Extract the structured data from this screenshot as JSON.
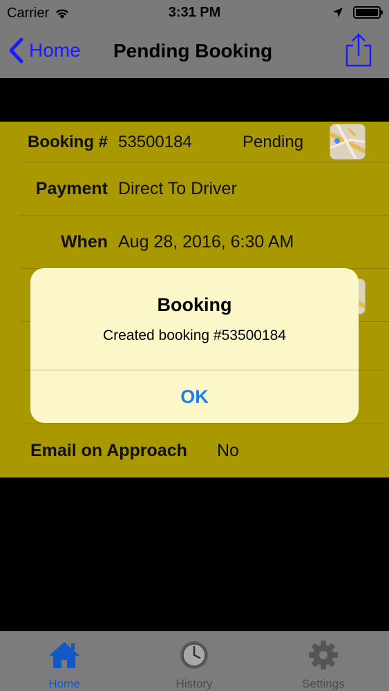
{
  "status_bar": {
    "carrier": "Carrier",
    "time": "3:31 PM"
  },
  "nav": {
    "back_label": "Home",
    "title": "Pending Booking"
  },
  "booking": {
    "label": "Booking #",
    "number": "53500184",
    "status": "Pending"
  },
  "payment": {
    "label": "Payment",
    "value": "Direct To Driver"
  },
  "when": {
    "label": "When",
    "value": "Aug 28, 2016, 6:30 AM"
  },
  "email_on_approach": {
    "label": "Email on Approach",
    "value": "No"
  },
  "alert": {
    "title": "Booking",
    "message": "Created booking #53500184",
    "ok_label": "OK"
  },
  "tabs": [
    {
      "label": "Home"
    },
    {
      "label": "History"
    },
    {
      "label": "Settings"
    }
  ],
  "colors": {
    "form_background": "#a99800",
    "accent_blue": "#1a1aff",
    "alert_button": "#1a7ff5",
    "active_tab": "#1558c4"
  }
}
